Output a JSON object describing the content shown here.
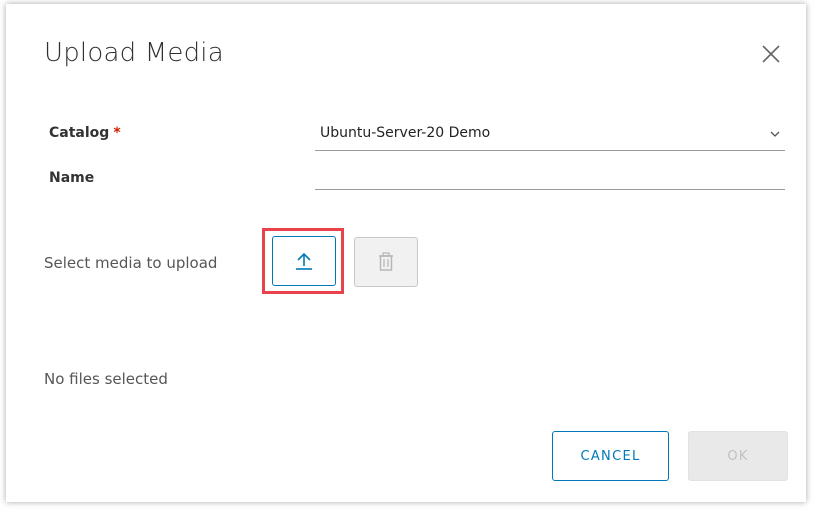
{
  "dialog": {
    "title": "Upload Media"
  },
  "form": {
    "catalog_label": "Catalog",
    "required_marker": "*",
    "catalog_value": "Ubuntu-Server-20 Demo",
    "name_label": "Name",
    "name_value": "",
    "upload_label": "Select media to upload",
    "files_status": "No files selected"
  },
  "footer": {
    "cancel_label": "CANCEL",
    "ok_label": "OK"
  },
  "icons": {
    "close": "close-icon",
    "chevron": "chevron-down-icon",
    "upload": "upload-icon",
    "delete": "trash-icon"
  },
  "colors": {
    "accent": "#0079b8",
    "required": "#c92100",
    "highlight": "#e8434a",
    "disabled_bg": "#e9e9e9",
    "disabled_text": "#c1c1c1"
  }
}
